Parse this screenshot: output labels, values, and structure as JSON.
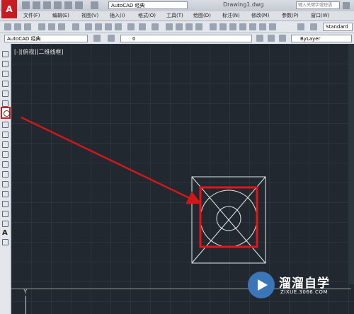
{
  "app": {
    "logo_letter": "A",
    "workspace": "AutoCAD 经典",
    "doc_title": "Drawing1.dwg",
    "search_placeholder": "键入关键字或短语"
  },
  "menu": {
    "items": [
      "文件(F)",
      "编辑(E)",
      "视图(V)",
      "插入(I)",
      "格式(O)",
      "工具(T)",
      "绘图(D)",
      "标注(N)",
      "修改(M)",
      "参数(P)",
      "窗口(W)"
    ]
  },
  "toolbar": {
    "text_style": "Standard",
    "workspace": "AutoCAD 经典",
    "layer": "0",
    "color": "ByLayer"
  },
  "viewport": {
    "label": "[-][俯视][二维线框]",
    "ucs_y": "Y"
  },
  "watermark": {
    "name": "溜溜自学",
    "url": "ZIXUE.3066.COM"
  },
  "colors": {
    "background": "#212830",
    "highlight": "#e0161b",
    "arrow": "#d01818",
    "drawing": "#e8e8e8"
  }
}
